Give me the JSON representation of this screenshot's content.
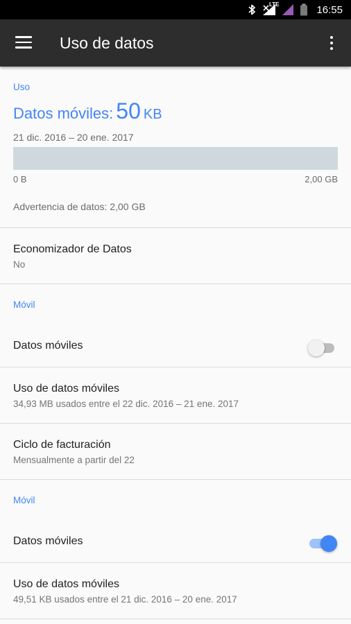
{
  "status_bar": {
    "network": "LTE",
    "time": "16:55",
    "icons": [
      "bluetooth-icon",
      "signal-icon",
      "signal-icon",
      "battery-icon"
    ]
  },
  "app_bar": {
    "title": "Uso de datos",
    "icons": [
      "menu-icon",
      "more-vert-icon"
    ]
  },
  "usage": {
    "section_label": "Uso",
    "summary_label": "Datos móviles:",
    "summary_value": "50",
    "summary_unit": "KB",
    "date_range": "21 dic. 2016 – 20 ene. 2017",
    "bar_fill_fraction": 0.0,
    "axis_min": "0 B",
    "axis_max": "2,00 GB",
    "warning": "Advertencia de datos: 2,00 GB"
  },
  "data_saver": {
    "title": "Economizador de Datos",
    "value": "No"
  },
  "sim1": {
    "section_label": "Móvil",
    "toggle_label": "Datos móviles",
    "toggle_on": false,
    "usage_title": "Uso de datos móviles",
    "usage_sub": "34,93 MB usados entre el 22 dic. 2016 – 21 ene. 2017",
    "billing_title": "Ciclo de facturación",
    "billing_sub": "Mensualmente a partir del 22"
  },
  "sim2": {
    "section_label": "Móvil",
    "toggle_label": "Datos móviles",
    "toggle_on": true,
    "usage_title": "Uso de datos móviles",
    "usage_sub": "49,51 KB usados entre el 21 dic. 2016 – 20 ene. 2017"
  },
  "colors": {
    "accent": "#4285f4",
    "app_bar": "#2d2d2d",
    "background": "#fafafa",
    "bar_track": "#cfd8dc"
  }
}
